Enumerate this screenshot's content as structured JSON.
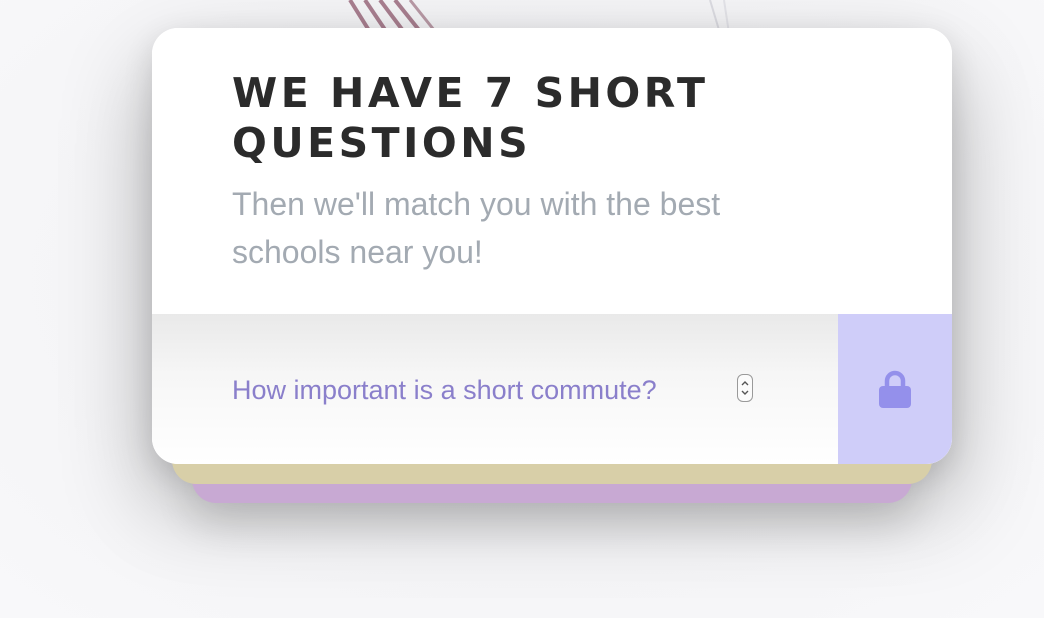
{
  "card": {
    "title": "WE HAVE 7 SHORT QUESTIONS",
    "subtitle": "Then we'll match you with the best schools near you!"
  },
  "question": {
    "current_value": "How important is a short commute?",
    "control_icon": "chevron-up-down-icon"
  },
  "lock": {
    "icon": "lock-icon"
  },
  "colors": {
    "title": "#2b2b2b",
    "subtitle": "#a3aab2",
    "question_text": "#8a7fcb",
    "lock_background": "#cfcdf9",
    "lock_icon": "#9490eb",
    "stack_layer_tan": "#d8cfa8",
    "stack_layer_purple": "#c8a9d3"
  }
}
